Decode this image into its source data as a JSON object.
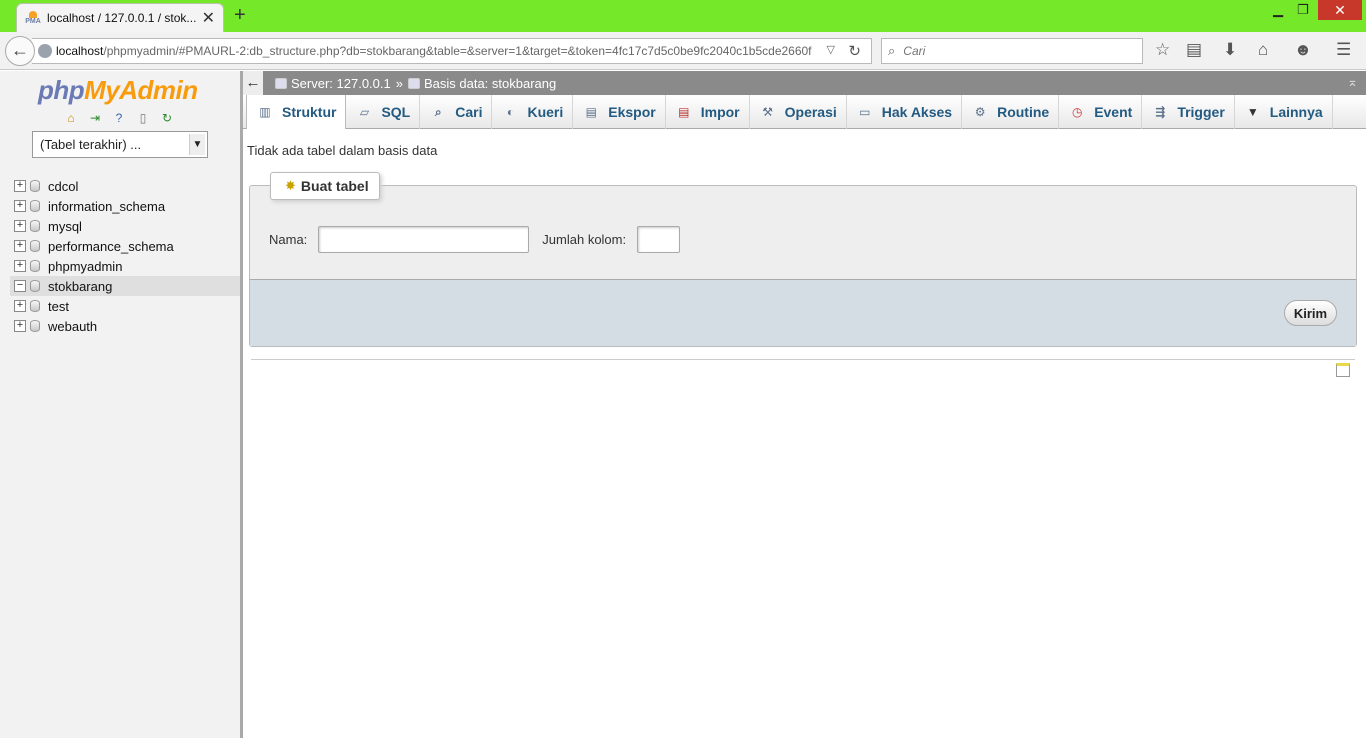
{
  "browser": {
    "tab_title": "localhost / 127.0.0.1 / stok...",
    "favicon_text": "PMA",
    "url_host": "localhost",
    "url_path": "/phpmyadmin/#PMAURL-2:db_structure.php?db=stokbarang&table=&server=1&target=&token=4fc17c7d5c0be9fc2040c1b5cde2660f",
    "search_placeholder": "Cari"
  },
  "sidebar": {
    "logo_php": "php",
    "logo_myadmin": "MyAdmin",
    "recent_tables": "(Tabel terakhir) ...",
    "databases": [
      {
        "name": "cdcol",
        "expander": "+"
      },
      {
        "name": "information_schema",
        "expander": "+"
      },
      {
        "name": "mysql",
        "expander": "+"
      },
      {
        "name": "performance_schema",
        "expander": "+"
      },
      {
        "name": "phpmyadmin",
        "expander": "+"
      },
      {
        "name": "stokbarang",
        "expander": "−"
      },
      {
        "name": "test",
        "expander": "+"
      },
      {
        "name": "webauth",
        "expander": "+"
      }
    ]
  },
  "breadcrumb": {
    "back": "←",
    "server": "Server: 127.0.0.1",
    "separator": "»",
    "database": "Basis data: stokbarang"
  },
  "tabs": [
    {
      "label": "Struktur",
      "icon": "structure-icon"
    },
    {
      "label": "SQL",
      "icon": "sql-icon"
    },
    {
      "label": "Cari",
      "icon": "search-icon"
    },
    {
      "label": "Kueri",
      "icon": "query-icon"
    },
    {
      "label": "Ekspor",
      "icon": "export-icon"
    },
    {
      "label": "Impor",
      "icon": "import-icon"
    },
    {
      "label": "Operasi",
      "icon": "wrench-icon"
    },
    {
      "label": "Hak Akses",
      "icon": "privileges-icon"
    },
    {
      "label": "Routine",
      "icon": "routine-icon"
    },
    {
      "label": "Event",
      "icon": "clock-icon"
    },
    {
      "label": "Trigger",
      "icon": "trigger-icon"
    },
    {
      "label": "Lainnya",
      "icon": "caret-down-icon"
    }
  ],
  "main": {
    "notice": "Tidak ada tabel dalam basis data",
    "create_table": {
      "legend": "Buat tabel",
      "name_label": "Nama:",
      "name_value": "",
      "columns_label": "Jumlah kolom:",
      "columns_value": "",
      "submit_label": "Kirim"
    }
  }
}
